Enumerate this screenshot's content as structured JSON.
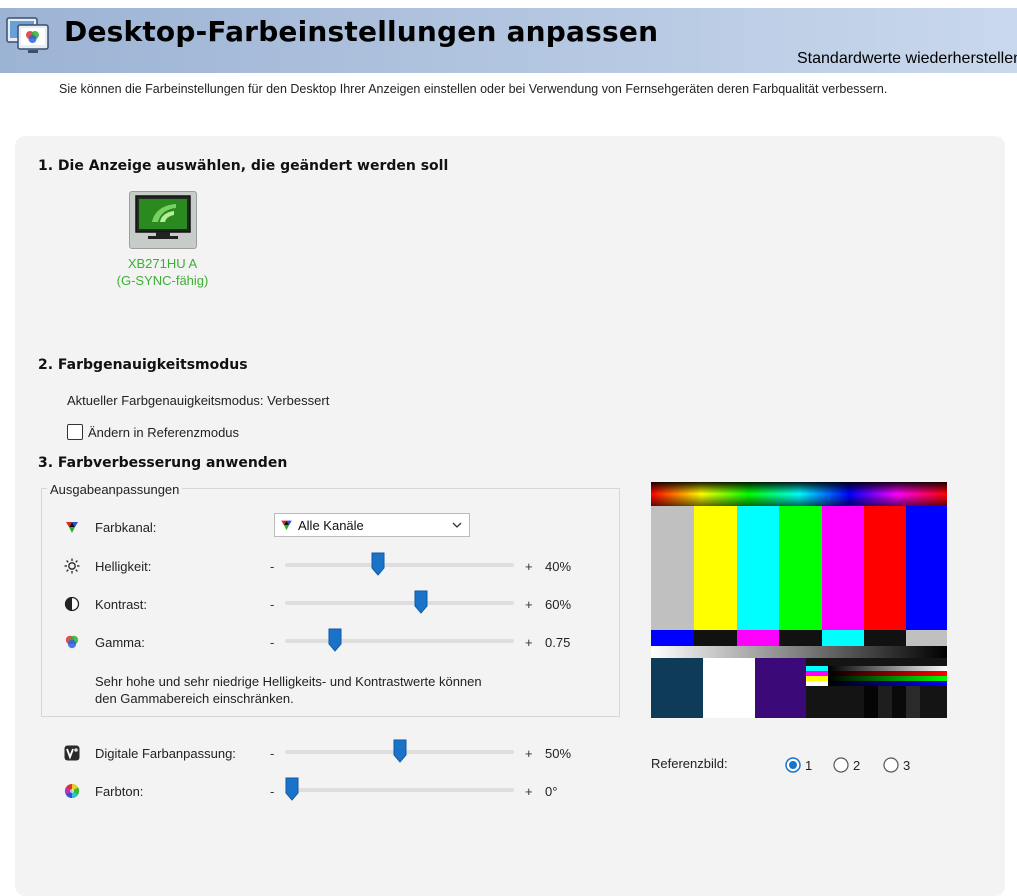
{
  "header": {
    "title": "Desktop-Farbeinstellungen anpassen",
    "restore_defaults": "Standardwerte wiederherstellen",
    "icon": "display-settings-icon"
  },
  "description": "Sie können die Farbeinstellungen für den Desktop Ihrer Anzeigen einstellen oder bei Verwendung von Fernsehgeräten deren Farbqualität verbessern.",
  "section1": {
    "heading": "1. Die Anzeige auswählen, die geändert werden soll",
    "display": {
      "name": "XB271HU A",
      "subtitle": "(G-SYNC-fähig)",
      "icon": "nvidia-monitor-icon"
    }
  },
  "section2": {
    "heading": "2. Farbgenauigkeitsmodus",
    "current_mode": "Aktueller Farbgenauigkeitsmodus: Verbessert",
    "reference_checkbox_label": "Ändern in Referenzmodus",
    "reference_checked": false
  },
  "section3": {
    "heading": "3. Farbverbesserung anwenden",
    "group_title": "Ausgabeanpassungen",
    "channel": {
      "label": "Farbkanal:",
      "value": "Alle Kanäle",
      "icon": "rgb-channels-icon"
    },
    "sliders": [
      {
        "label": "Helligkeit:",
        "minus": "-",
        "plus": "+",
        "value_text": "40%",
        "position": 0.4,
        "icon": "brightness-icon"
      },
      {
        "label": "Kontrast:",
        "minus": "-",
        "plus": "+",
        "value_text": "60%",
        "position": 0.6,
        "icon": "contrast-icon"
      },
      {
        "label": "Gamma:",
        "minus": "-",
        "plus": "+",
        "value_text": "0.75",
        "position": 0.2,
        "icon": "gamma-icon"
      }
    ],
    "note_line1": "Sehr hohe und sehr niedrige Helligkeits- und Kontrastwerte können",
    "note_line2": "den Gammabereich einschränken.",
    "extra_sliders": [
      {
        "label": "Digitale Farbanpassung:",
        "minus": "-",
        "plus": "+",
        "value_text": "50%",
        "position": 0.5,
        "icon": "digital-vibrance-icon"
      },
      {
        "label": "Farbton:",
        "minus": "-",
        "plus": "+",
        "value_text": "0°",
        "position": 0.0,
        "icon": "hue-icon"
      }
    ]
  },
  "reference": {
    "label": "Referenzbild:",
    "options": [
      "1",
      "2",
      "3"
    ],
    "selected": "1"
  },
  "colors": {
    "accent": "#1a73c9",
    "nvidia_green": "#3fae36",
    "header_blue": "#9cb3d4"
  }
}
